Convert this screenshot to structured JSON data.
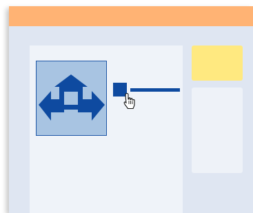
{
  "window": {
    "title": ""
  },
  "canvas": {
    "shape": {
      "icon": "four-way-arrows-icon",
      "selected": true
    },
    "connector": {
      "handle_icon": "connector-handle",
      "cursor_icon": "hand-pointer-cursor"
    }
  },
  "side_panel": {
    "sticky_note_text": "",
    "card_text": ""
  },
  "colors": {
    "title_bar": "#ffb374",
    "window_bg": "#dfe6f2",
    "canvas_bg": "#eff3f9",
    "selection_fill": "#a8c4e2",
    "accent": "#0e4aa0",
    "sticky_note": "#ffe980"
  }
}
